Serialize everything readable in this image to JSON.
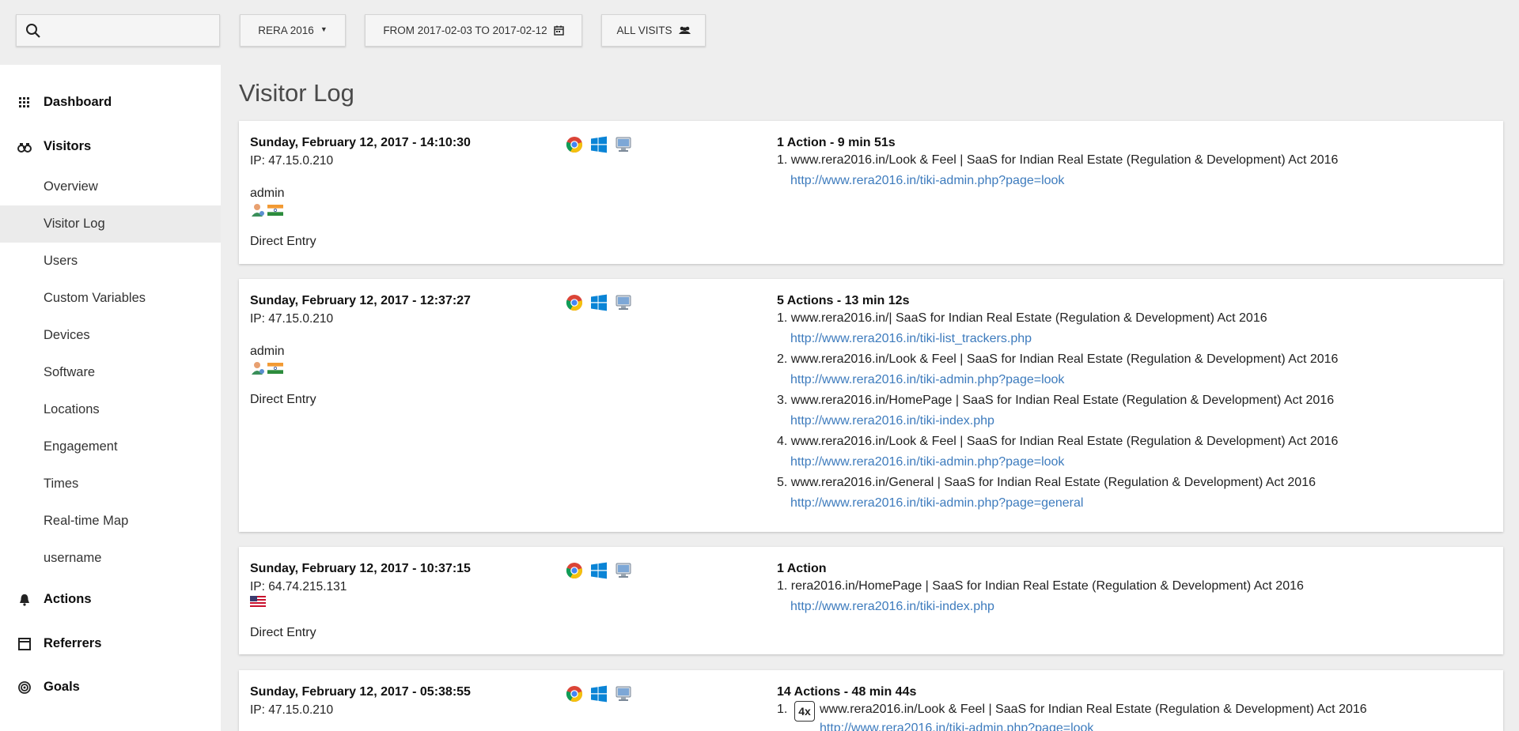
{
  "topbar": {
    "site": "RERA 2016",
    "date_range": "FROM 2017-02-03 TO 2017-02-12",
    "segment": "ALL VISITS"
  },
  "sidebar": {
    "dashboard": "Dashboard",
    "visitors": "Visitors",
    "sub": [
      "Overview",
      "Visitor Log",
      "Users",
      "Custom Variables",
      "Devices",
      "Software",
      "Locations",
      "Engagement",
      "Times",
      "Real-time Map",
      "username"
    ],
    "actions": "Actions",
    "referrers": "Referrers",
    "goals": "Goals"
  },
  "page_title": "Visitor Log",
  "visits": [
    {
      "date": "Sunday, February 12, 2017 - 14:10:30",
      "ip": "IP: 47.15.0.210",
      "user": "admin",
      "referrer": "Direct Entry",
      "summary": "1 Action - 9 min 51s",
      "actions": [
        {
          "title": "1. www.rera2016.in/Look & Feel | SaaS for Indian Real Estate (Regulation & Development) Act 2016",
          "url": "http://www.rera2016.in/tiki-admin.php?page=look"
        }
      ]
    },
    {
      "date": "Sunday, February 12, 2017 - 12:37:27",
      "ip": "IP: 47.15.0.210",
      "user": "admin",
      "referrer": "Direct Entry",
      "summary": "5 Actions - 13 min 12s",
      "actions": [
        {
          "title": "1. www.rera2016.in/| SaaS for Indian Real Estate (Regulation & Development) Act 2016",
          "url": "http://www.rera2016.in/tiki-list_trackers.php"
        },
        {
          "title": "2. www.rera2016.in/Look & Feel | SaaS for Indian Real Estate (Regulation & Development) Act 2016",
          "url": "http://www.rera2016.in/tiki-admin.php?page=look"
        },
        {
          "title": "3. www.rera2016.in/HomePage | SaaS for Indian Real Estate (Regulation & Development) Act 2016",
          "url": "http://www.rera2016.in/tiki-index.php"
        },
        {
          "title": "4. www.rera2016.in/Look & Feel | SaaS for Indian Real Estate (Regulation & Development) Act 2016",
          "url": "http://www.rera2016.in/tiki-admin.php?page=look"
        },
        {
          "title": "5. www.rera2016.in/General | SaaS for Indian Real Estate (Regulation & Development) Act 2016",
          "url": "http://www.rera2016.in/tiki-admin.php?page=general"
        }
      ]
    },
    {
      "date": "Sunday, February 12, 2017 - 10:37:15",
      "ip": "IP: 64.74.215.131",
      "referrer": "Direct Entry",
      "summary": "1 Action",
      "actions": [
        {
          "title": "1. rera2016.in/HomePage | SaaS for Indian Real Estate (Regulation & Development) Act 2016",
          "url": "http://www.rera2016.in/tiki-index.php"
        }
      ]
    },
    {
      "date": "Sunday, February 12, 2017 - 05:38:55",
      "ip": "IP: 47.15.0.210",
      "summary": "14 Actions - 48 min 44s",
      "actions": [
        {
          "num": "1.",
          "repeat": "4x",
          "title": "www.rera2016.in/Look & Feel | SaaS for Indian Real Estate (Regulation & Development) Act 2016",
          "url": "http://www.rera2016.in/tiki-admin.php?page=look"
        }
      ]
    }
  ],
  "colors": {
    "link": "#3d7bbd",
    "active_sidebar": "#ebebeb"
  }
}
